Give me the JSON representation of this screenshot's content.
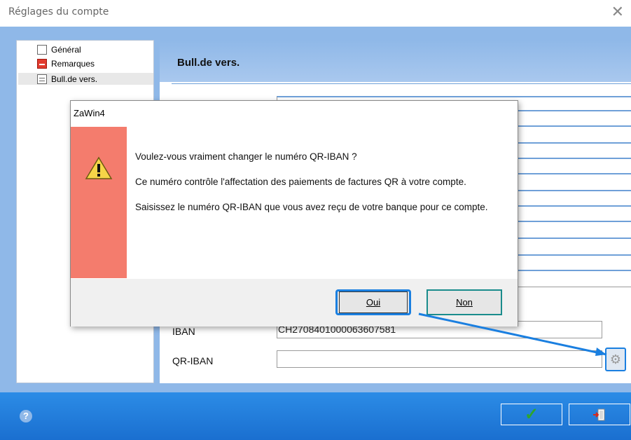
{
  "window": {
    "title": "Réglages du compte",
    "close_glyph": "✕"
  },
  "tree": {
    "items": [
      {
        "label": "Général",
        "icon": "document-icon"
      },
      {
        "label": "Remarques",
        "icon": "notes-red-icon"
      },
      {
        "label": "Bull.de vers.",
        "icon": "payment-slip-icon",
        "selected": true
      }
    ]
  },
  "panel": {
    "title": "Bull.de vers.",
    "iban_label": "IBAN",
    "iban_value": "CH2708401000063607581",
    "qr_iban_label": "QR-IBAN",
    "qr_iban_value": ""
  },
  "dialog": {
    "title": "ZaWin4",
    "icon": "warning-icon",
    "paragraphs": [
      "Voulez-vous vraiment changer le numéro QR-IBAN ?",
      "Ce numéro contrôle l'affectation des paiements de factures QR à votre compte.",
      "Saisissez le numéro QR-IBAN que vous avez reçu de votre banque pour ce compte."
    ],
    "yes_label": "Oui",
    "no_label": "Non"
  },
  "bottombar": {
    "help_glyph": "?",
    "ok_glyph": "✓",
    "exit_icon": "exit-door-icon"
  },
  "colors": {
    "accent_blue": "#1a7fe0",
    "warning_bar": "#f47c6d",
    "bottom_bar": "#1e7ad8"
  }
}
